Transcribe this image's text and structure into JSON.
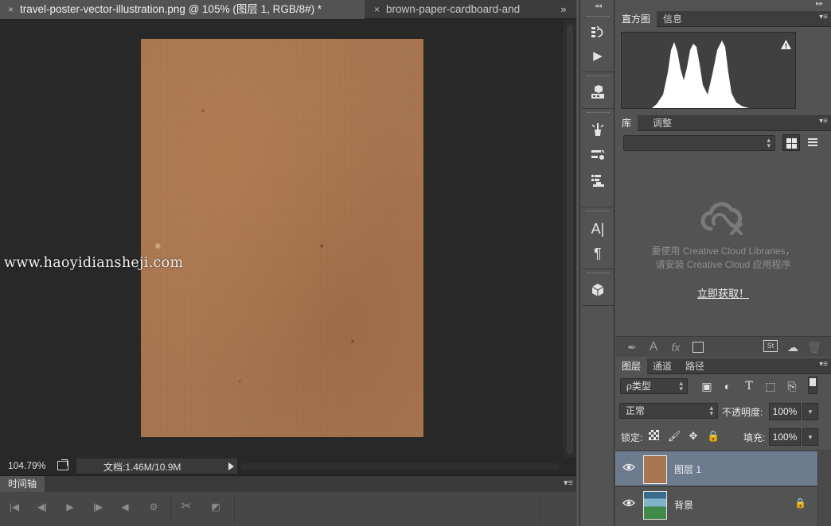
{
  "document_tabs": {
    "active": {
      "close": "×",
      "label": "travel-poster-vector-illustration.png @ 105% (图层 1, RGB/8#) *"
    },
    "inactive": {
      "close": "×",
      "label": "brown-paper-cardboard-and"
    },
    "overflow": "»"
  },
  "canvas": {
    "watermark": "www.haoyidiansheji.com",
    "paper_color": "#a77650"
  },
  "status_bar": {
    "zoom": "104.79%",
    "doc_info": "文档:1.46M/10.9M"
  },
  "timeline": {
    "tab_label": "时间轴",
    "controls": [
      "first-frame-icon",
      "prev-frame-icon",
      "play-icon",
      "next-frame-icon",
      "audio-icon",
      "settings-icon",
      "scissors-icon",
      "transition-icon"
    ]
  },
  "tool_strip": {
    "buttons": [
      "history-icon",
      "actions-play-icon",
      "3d-material-icon",
      "brush-presets-icon",
      "clone-source-icon",
      "tool-presets-icon",
      "character-icon",
      "paragraph-icon",
      "3d-cube-icon"
    ],
    "glyphs": {
      "character": "A|",
      "paragraph": "¶"
    }
  },
  "histogram_panel": {
    "tabs": [
      "直方图",
      "信息"
    ],
    "warning": "!"
  },
  "library_panel": {
    "tabs": [
      "库",
      "调整"
    ],
    "message_line1": "要使用 Creative Cloud Libraries，",
    "message_line2": "请安装 Creative Cloud 应用程序",
    "link": "立即获取！",
    "footer_glyphs": {
      "text": "A",
      "fx": "fx",
      "st": "St"
    }
  },
  "layers_panel": {
    "tabs": [
      "图层",
      "通道",
      "路径"
    ],
    "filter_kind": "ρ类型",
    "filter_glyph_text": "T",
    "blend_mode": "正常",
    "opacity_label": "不透明度:",
    "opacity_value": "100%",
    "lock_label": "锁定:",
    "fill_label": "填充:",
    "fill_value": "100%",
    "layers": [
      {
        "name": "图层 1",
        "selected": true,
        "locked": false
      },
      {
        "name": "背景",
        "selected": false,
        "locked": true
      }
    ]
  },
  "colors": {
    "selection": "#6d7b8f",
    "panel_bg": "#535353",
    "canvas_bg": "#282828"
  }
}
